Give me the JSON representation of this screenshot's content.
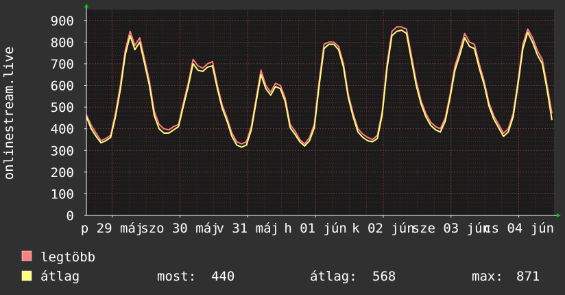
{
  "chart_data": {
    "type": "line",
    "ylabel": "onlinestream.live",
    "ylim": [
      0,
      950
    ],
    "yticks": [
      0,
      100,
      200,
      300,
      400,
      500,
      600,
      700,
      800,
      900
    ],
    "x_tick_labels": [
      "p 29 máj",
      "szo 30 máj",
      "v 31 máj",
      "h 01 jún",
      "k 02 jún",
      "sze 03 jún",
      "cs 04 jún"
    ],
    "grid": true,
    "colors": {
      "background": "#303030",
      "plot_background": "#1b1b1b",
      "minor_grid": "#6a3030",
      "axis": "#ffffff",
      "arrow": "#00cc00"
    },
    "series": [
      {
        "name": "legtöbb",
        "color": "#ff7f7f",
        "values": [
          465,
          415,
          380,
          345,
          355,
          370,
          470,
          600,
          760,
          850,
          785,
          820,
          720,
          620,
          480,
          420,
          400,
          395,
          410,
          420,
          520,
          610,
          720,
          690,
          680,
          700,
          710,
          600,
          510,
          450,
          380,
          340,
          330,
          340,
          410,
          540,
          670,
          600,
          570,
          610,
          600,
          540,
          420,
          390,
          350,
          330,
          360,
          420,
          620,
          790,
          800,
          800,
          780,
          700,
          560,
          470,
          400,
          375,
          360,
          350,
          370,
          480,
          700,
          850,
          870,
          870,
          860,
          740,
          620,
          530,
          470,
          430,
          410,
          400,
          450,
          560,
          690,
          760,
          840,
          800,
          790,
          700,
          620,
          520,
          460,
          420,
          380,
          400,
          470,
          620,
          790,
          860,
          820,
          760,
          720,
          600,
          470
        ],
        "legend_label": "legtöbb"
      },
      {
        "name": "átlag",
        "color": "#ffff80",
        "values": [
          455,
          400,
          365,
          335,
          345,
          360,
          455,
          580,
          740,
          830,
          765,
          800,
          700,
          600,
          460,
          400,
          380,
          380,
          395,
          410,
          505,
          595,
          700,
          670,
          665,
          685,
          690,
          585,
          495,
          435,
          365,
          325,
          315,
          325,
          395,
          525,
          650,
          585,
          555,
          595,
          585,
          525,
          405,
          375,
          340,
          320,
          345,
          405,
          600,
          770,
          790,
          790,
          765,
          685,
          545,
          455,
          385,
          360,
          345,
          340,
          355,
          465,
          680,
          830,
          850,
          855,
          840,
          720,
          600,
          515,
          455,
          415,
          395,
          385,
          435,
          545,
          670,
          740,
          820,
          780,
          770,
          680,
          605,
          505,
          445,
          405,
          365,
          385,
          455,
          605,
          770,
          845,
          800,
          740,
          700,
          580,
          440
        ],
        "legend_label": "átlag"
      }
    ],
    "legend": [
      {
        "label": "legtöbb",
        "color": "#ff7f7f"
      },
      {
        "label": "átlag",
        "color": "#ffff80"
      }
    ],
    "stats": {
      "most_label": "most:",
      "most_value": "440",
      "avg_label": "átlag:",
      "avg_value": "568",
      "max_label": "max:",
      "max_value": "871"
    }
  }
}
